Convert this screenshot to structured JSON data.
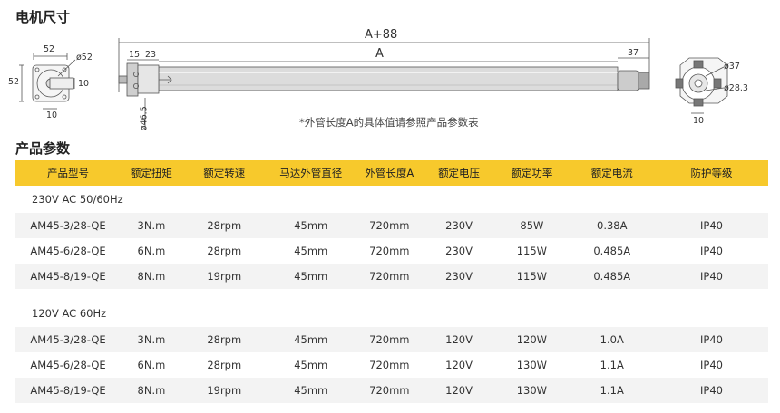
{
  "sections": {
    "dimensions_title": "电机尺寸",
    "specs_title": "产品参数"
  },
  "drawing": {
    "labels": {
      "left_width": "52",
      "left_dia": "ø52",
      "left_height": "52",
      "left_side": "10",
      "left_bottom": "10",
      "overall": "A+88",
      "tube": "A",
      "head_offset_1": "15",
      "head_offset_2": "23",
      "tail": "37",
      "head_dia": "ø46.5",
      "right_dia_1": "ø37",
      "right_dia_2": "ø28.3",
      "right_bottom": "10"
    },
    "note": "*外管长度A的具体值请参照产品参数表"
  },
  "table": {
    "headers": [
      "产品型号",
      "额定扭矩",
      "额定转速",
      "马达外管直径",
      "外管长度A",
      "额定电压",
      "额定功率",
      "额定电流",
      "防护等级"
    ],
    "groups": [
      {
        "label": "230V AC 50/60Hz",
        "rows": [
          [
            "AM45-3/28-QE",
            "3N.m",
            "28rpm",
            "45mm",
            "720mm",
            "230V",
            "85W",
            "0.38A",
            "IP40"
          ],
          [
            "AM45-6/28-QE",
            "6N.m",
            "28rpm",
            "45mm",
            "720mm",
            "230V",
            "115W",
            "0.485A",
            "IP40"
          ],
          [
            "AM45-8/19-QE",
            "8N.m",
            "19rpm",
            "45mm",
            "720mm",
            "230V",
            "115W",
            "0.485A",
            "IP40"
          ]
        ]
      },
      {
        "label": "120V AC 60Hz",
        "rows": [
          [
            "AM45-3/28-QE",
            "3N.m",
            "28rpm",
            "45mm",
            "720mm",
            "120V",
            "120W",
            "1.0A",
            "IP40"
          ],
          [
            "AM45-6/28-QE",
            "6N.m",
            "28rpm",
            "45mm",
            "720mm",
            "120V",
            "130W",
            "1.1A",
            "IP40"
          ],
          [
            "AM45-8/19-QE",
            "8N.m",
            "19rpm",
            "45mm",
            "720mm",
            "120V",
            "130W",
            "1.1A",
            "IP40"
          ]
        ]
      }
    ]
  },
  "colors": {
    "header_bg": "#f7c92c",
    "row_shade": "#f3f3f3"
  }
}
